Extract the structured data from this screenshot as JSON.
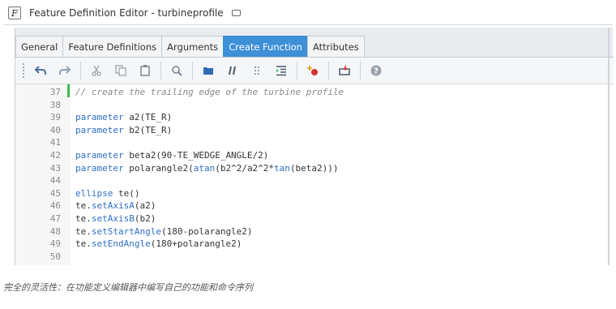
{
  "window": {
    "title": "Feature Definition Editor - turbineprofile",
    "app_icon_glyph": "F"
  },
  "tabs": [
    {
      "label": "General",
      "active": false
    },
    {
      "label": "Feature Definitions",
      "active": false
    },
    {
      "label": "Arguments",
      "active": false
    },
    {
      "label": "Create Function",
      "active": true
    },
    {
      "label": "Attributes",
      "active": false
    }
  ],
  "toolbar": {
    "icons": [
      "undo-icon",
      "redo-icon",
      "cut-icon",
      "copy-icon",
      "paste-icon",
      "find-icon",
      "bookmark-icon",
      "comment-icon",
      "grid-icon",
      "indent-icon",
      "add-breakpoint-icon",
      "insert-icon",
      "help-icon"
    ]
  },
  "code_lines": [
    {
      "num": "37",
      "tokens": [
        {
          "t": "// create the trailing edge of the turbine profile",
          "c": "cm"
        }
      ]
    },
    {
      "num": "38",
      "tokens": []
    },
    {
      "num": "39",
      "tokens": [
        {
          "t": "parameter",
          "c": "kw"
        },
        {
          "t": " a2(TE_R)",
          "c": ""
        }
      ]
    },
    {
      "num": "40",
      "tokens": [
        {
          "t": "parameter",
          "c": "kw"
        },
        {
          "t": " b2(TE_R)",
          "c": ""
        }
      ]
    },
    {
      "num": "41",
      "tokens": []
    },
    {
      "num": "42",
      "tokens": [
        {
          "t": "parameter",
          "c": "kw"
        },
        {
          "t": " beta2(90-TE_WEDGE_ANGLE/2)",
          "c": ""
        }
      ]
    },
    {
      "num": "43",
      "tokens": [
        {
          "t": "parameter",
          "c": "kw"
        },
        {
          "t": " polarangle2(",
          "c": ""
        },
        {
          "t": "atan",
          "c": "kw"
        },
        {
          "t": "(b2^2/a2^2*",
          "c": ""
        },
        {
          "t": "tan",
          "c": "kw"
        },
        {
          "t": "(beta2)))",
          "c": ""
        }
      ]
    },
    {
      "num": "44",
      "tokens": []
    },
    {
      "num": "45",
      "tokens": [
        {
          "t": "ellipse",
          "c": "kw"
        },
        {
          "t": " te()",
          "c": ""
        }
      ]
    },
    {
      "num": "46",
      "tokens": [
        {
          "t": "te.",
          "c": ""
        },
        {
          "t": "setAxisA",
          "c": "kw"
        },
        {
          "t": "(a2)",
          "c": ""
        }
      ]
    },
    {
      "num": "47",
      "tokens": [
        {
          "t": "te.",
          "c": ""
        },
        {
          "t": "setAxisB",
          "c": "kw"
        },
        {
          "t": "(b2)",
          "c": ""
        }
      ]
    },
    {
      "num": "48",
      "tokens": [
        {
          "t": "te.",
          "c": ""
        },
        {
          "t": "setStartAngle",
          "c": "kw"
        },
        {
          "t": "(180-polarangle2)",
          "c": ""
        }
      ]
    },
    {
      "num": "49",
      "tokens": [
        {
          "t": "te.",
          "c": ""
        },
        {
          "t": "setEndAngle",
          "c": "kw"
        },
        {
          "t": "(180+polarangle2)",
          "c": ""
        }
      ]
    },
    {
      "num": "50",
      "tokens": []
    }
  ],
  "caption": "完全的灵活性：在功能定义编辑器中编写自己的功能和命令序列",
  "colors": {
    "active_tab": "#3d8fd6",
    "keyword": "#2e6fc4",
    "change_marker": "#3cba54"
  }
}
